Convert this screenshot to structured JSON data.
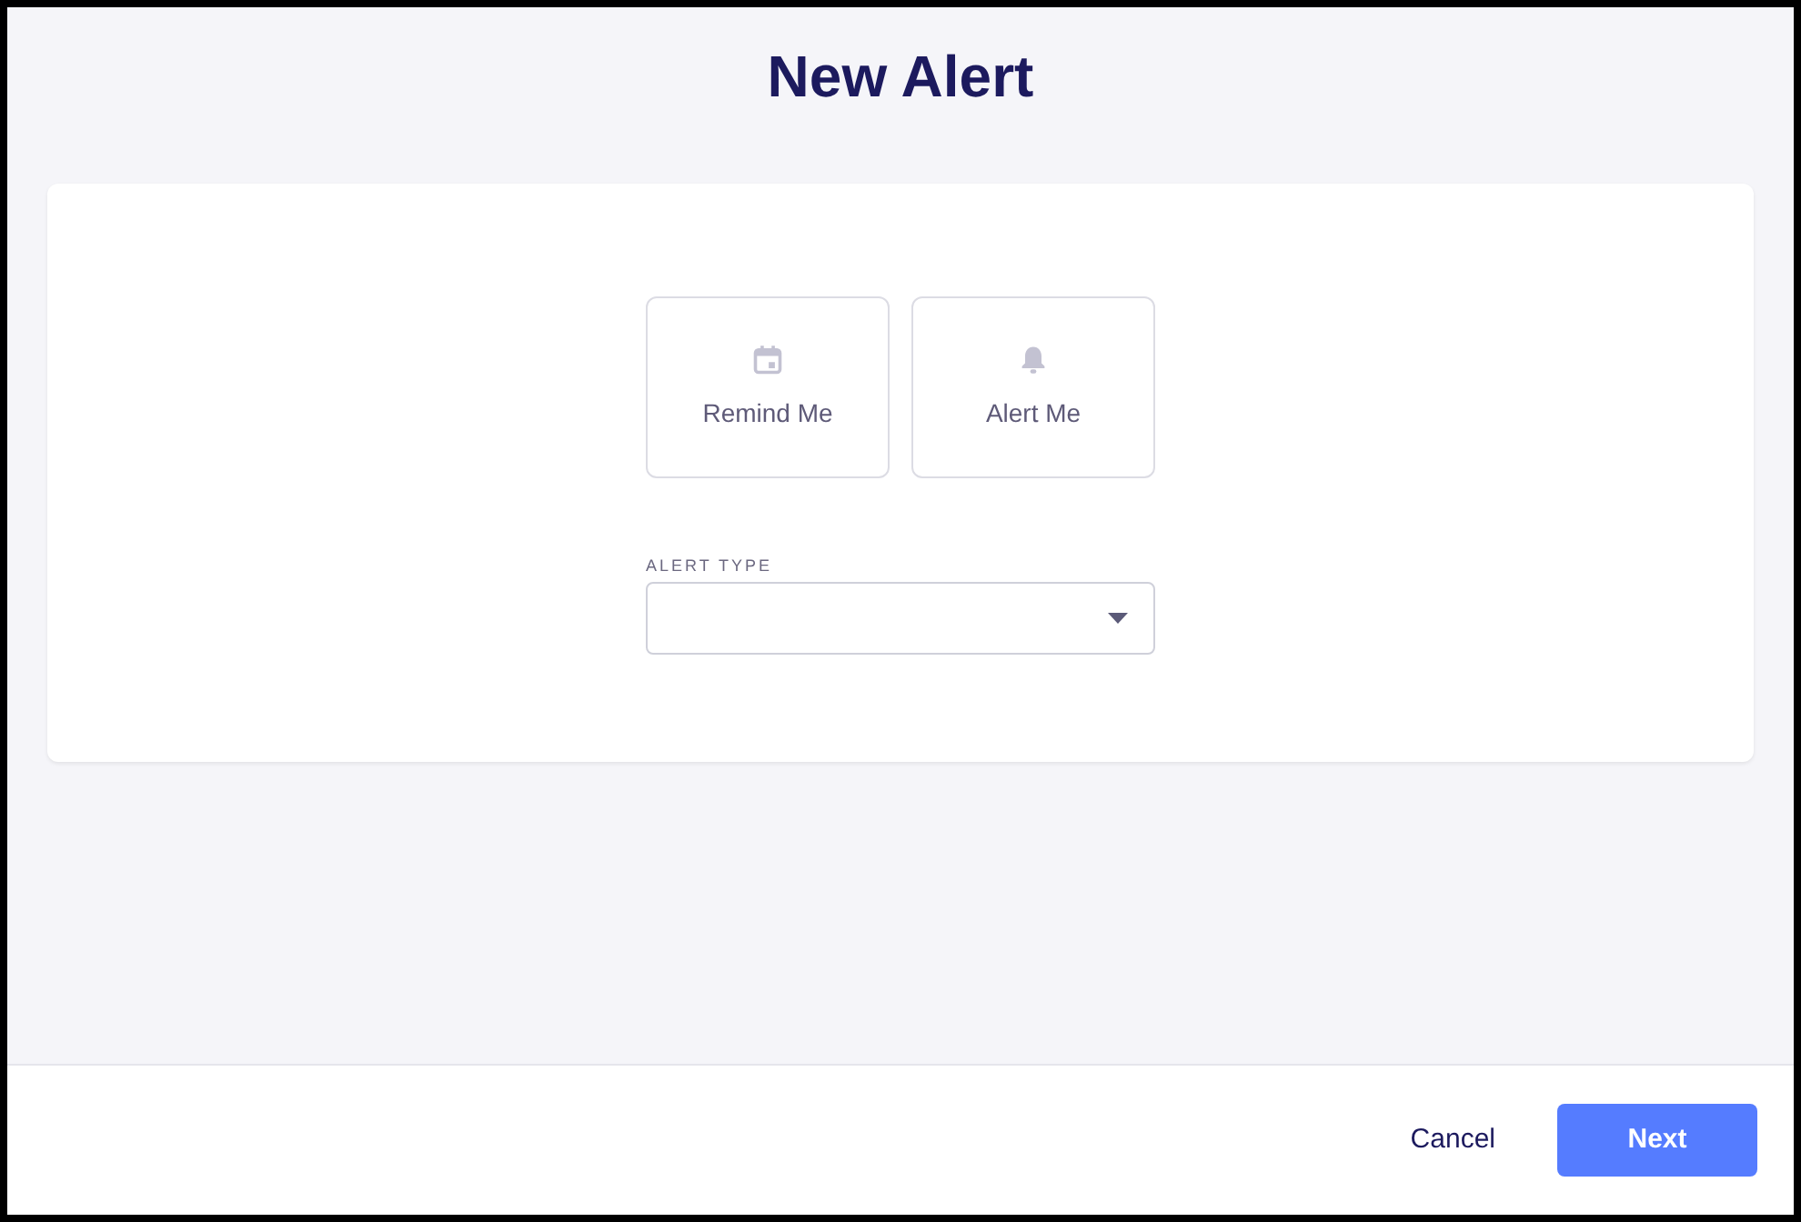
{
  "title": "New Alert",
  "options": [
    {
      "kind": "calendar",
      "label": "Remind Me",
      "selected": false
    },
    {
      "kind": "bell",
      "label": "Alert Me",
      "selected": false
    }
  ],
  "alert_type": {
    "label": "ALERT TYPE"
  },
  "buttons": {
    "cancel": "Cancel",
    "next": "Next"
  }
}
